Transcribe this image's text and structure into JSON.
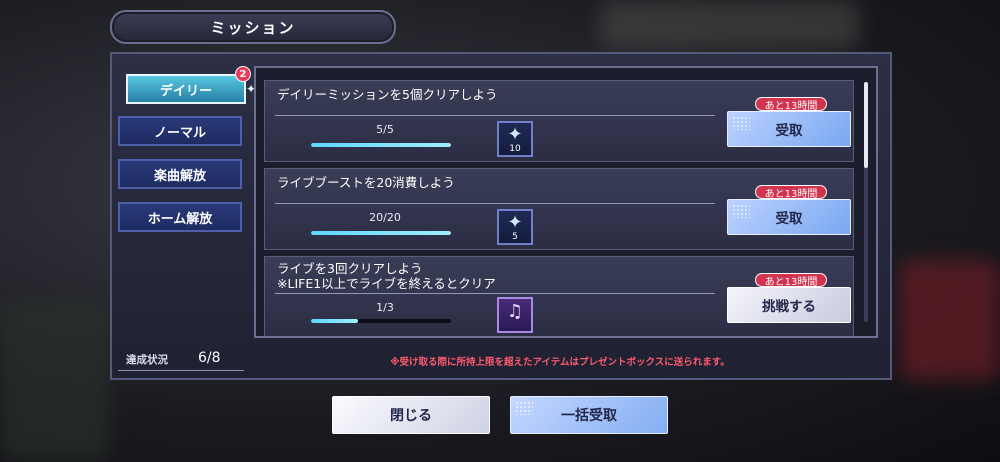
{
  "header": {
    "title": "ミッション"
  },
  "tabs": [
    {
      "label": "デイリー",
      "active": true,
      "badge": "2"
    },
    {
      "label": "ノーマル",
      "active": false
    },
    {
      "label": "楽曲解放",
      "active": false
    },
    {
      "label": "ホーム解放",
      "active": false
    }
  ],
  "missions": [
    {
      "title": "デイリーミッションを5個クリアしよう",
      "progress": "5/5",
      "progress_fraction": 1.0,
      "reward_count": "10",
      "timer": "あと13時間",
      "button": "受取"
    },
    {
      "title": "ライブブーストを20消費しよう",
      "progress": "20/20",
      "progress_fraction": 1.0,
      "reward_count": "5",
      "timer": "あと13時間",
      "button": "受取"
    },
    {
      "title_line1": "ライブを3回クリアしよう",
      "title_line2": "※LIFE1以上でライブを終えるとクリア",
      "progress": "1/3",
      "progress_fraction": 0.333,
      "timer": "あと13時間",
      "button": "挑戦する"
    }
  ],
  "status": {
    "label": "達成状況",
    "value": "6/8"
  },
  "notice": "※受け取る際に所持上限を超えたアイテムはプレゼントボックスに送られます。",
  "footer": {
    "close_label": "閉じる",
    "claim_all_label": "一括受取"
  },
  "colors": {
    "accent": "#56c8e0",
    "timer_red": "#d2334f",
    "notice_red": "#ff5a6e"
  }
}
